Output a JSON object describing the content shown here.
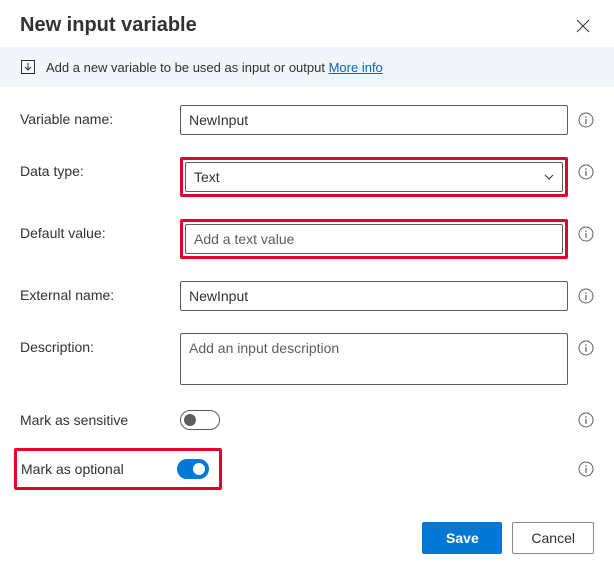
{
  "header": {
    "title": "New input variable"
  },
  "infobar": {
    "text": "Add a new variable to be used as input or output",
    "link_label": "More info"
  },
  "labels": {
    "variable_name": "Variable name:",
    "data_type": "Data type:",
    "default_value": "Default value:",
    "external_name": "External name:",
    "description": "Description:",
    "mark_sensitive": "Mark as sensitive",
    "mark_optional": "Mark as optional"
  },
  "fields": {
    "variable_name": {
      "value": "NewInput"
    },
    "data_type": {
      "value": "Text"
    },
    "default_value": {
      "value": "",
      "placeholder": "Add a text value"
    },
    "external_name": {
      "value": "NewInput"
    },
    "description": {
      "value": "",
      "placeholder": "Add an input description"
    },
    "mark_sensitive": false,
    "mark_optional": true
  },
  "footer": {
    "save": "Save",
    "cancel": "Cancel"
  }
}
